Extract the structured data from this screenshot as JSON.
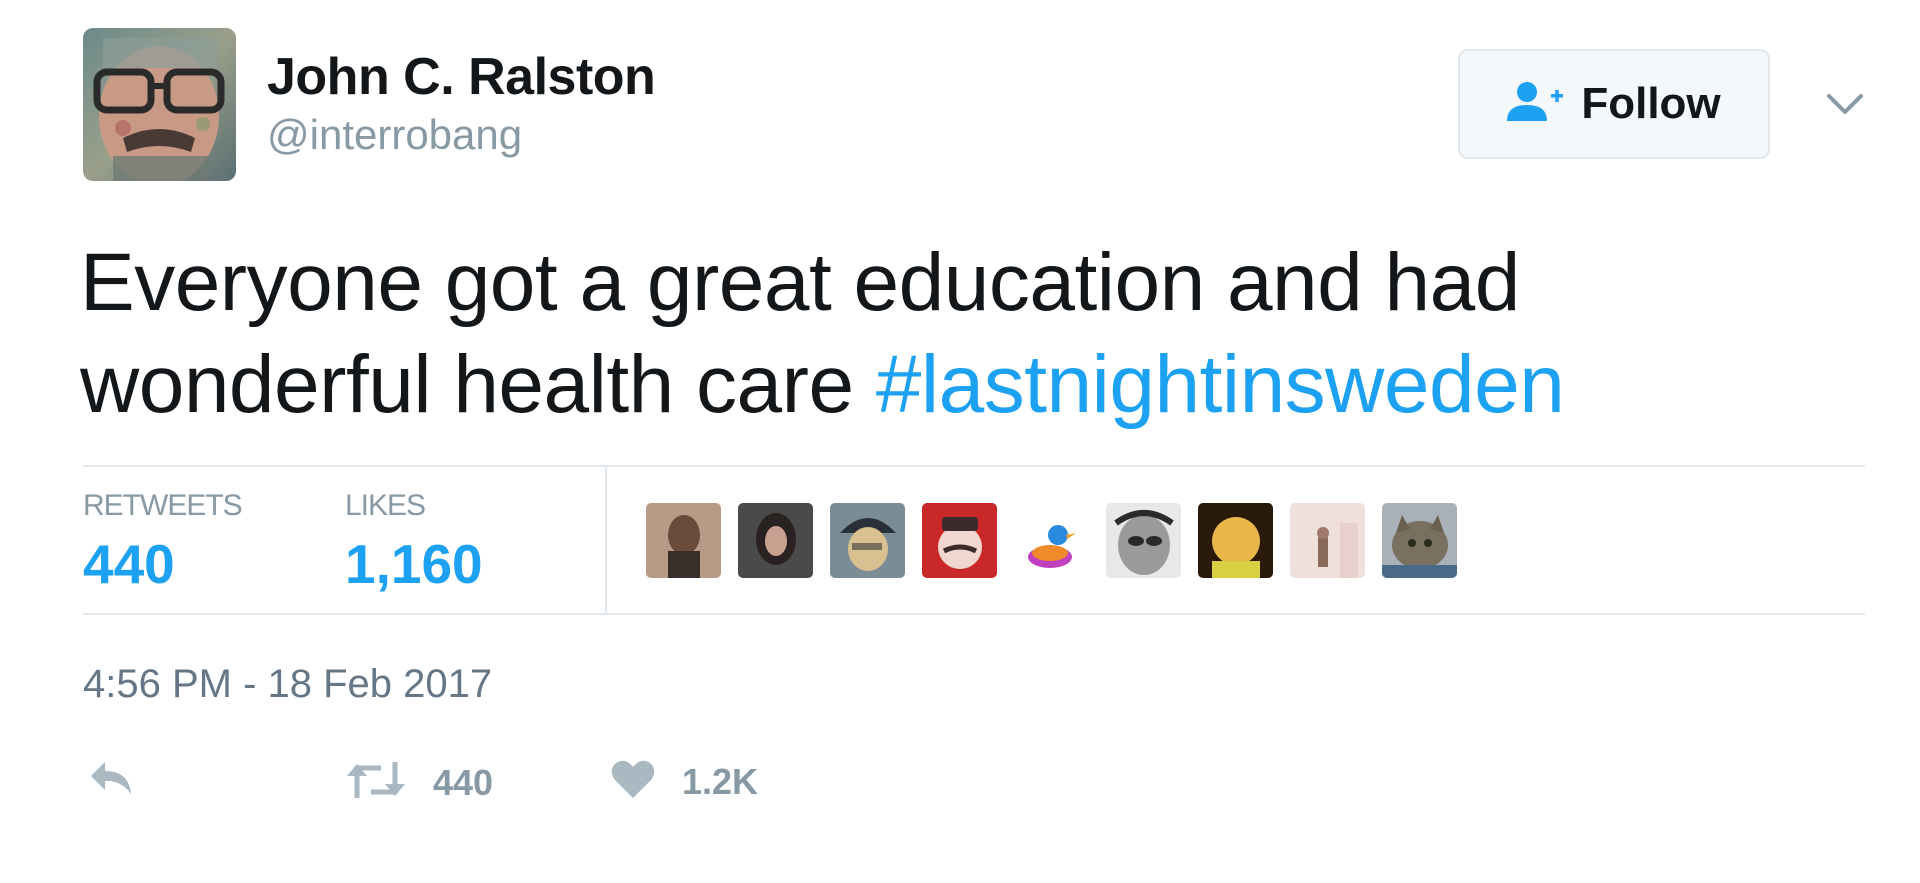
{
  "tweet": {
    "author": {
      "name": "John C. Ralston",
      "handle": "@interrobang"
    },
    "follow_label": "Follow",
    "text_prefix": "Everyone got a great education and had wonderful health care ",
    "hashtag": "#lastnightinsweden",
    "stats": {
      "retweets_label": "RETWEETS",
      "retweets_value": "440",
      "likes_label": "LIKES",
      "likes_value": "1,160"
    },
    "timestamp": "4:56 PM - 18 Feb 2017",
    "actions": {
      "retweet_count": "440",
      "like_count": "1.2K"
    }
  },
  "colors": {
    "accent": "#1da1f2",
    "muted": "#8899a6",
    "text": "#14171a",
    "border": "#e1e8ed"
  },
  "icons": [
    "user-plus-icon",
    "chevron-down-icon",
    "reply-icon",
    "retweet-icon",
    "heart-icon"
  ]
}
